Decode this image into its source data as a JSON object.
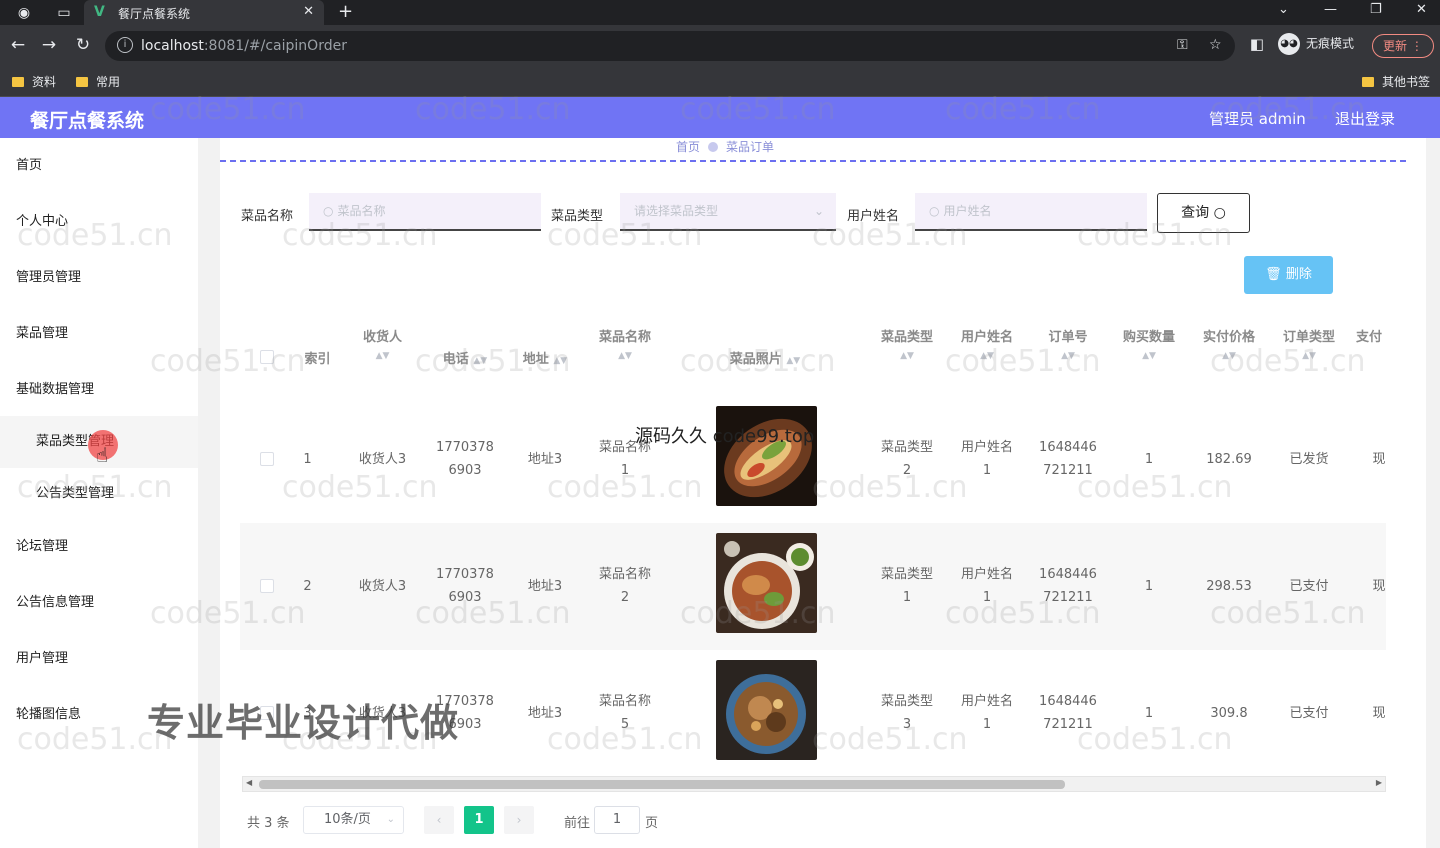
{
  "browser": {
    "tab_title": "餐厅点餐系统",
    "url_host": "localhost",
    "url_rest": ":8081/#/caipinOrder",
    "incognito_label": "无痕模式",
    "update_label": "更新",
    "bookmarks": [
      "资料",
      "常用"
    ],
    "other_bookmarks": "其他书签"
  },
  "header": {
    "title": "餐厅点餐系统",
    "user": "管理员 admin",
    "logout": "退出登录"
  },
  "sidebar": {
    "items": [
      "首页",
      "个人中心",
      "管理员管理",
      "菜品管理",
      "基础数据管理",
      "菜品类型管理",
      "公告类型管理",
      "论坛管理",
      "公告信息管理",
      "用户管理",
      "轮播图信息"
    ]
  },
  "breadcrumb": {
    "home": "首页",
    "current": "菜品订单"
  },
  "filters": {
    "dish_name_label": "菜品名称",
    "dish_name_placeholder": "菜品名称",
    "dish_type_label": "菜品类型",
    "dish_type_placeholder": "请选择菜品类型",
    "user_name_label": "用户姓名",
    "user_name_placeholder": "用户姓名",
    "query_label": "查询",
    "delete_label": "删除"
  },
  "table": {
    "headers": {
      "index": "索引",
      "receiver": "收货人",
      "phone": "电话",
      "address": "地址",
      "dish_name": "菜品名称",
      "dish_photo": "菜品照片",
      "dish_type": "菜品类型",
      "user_name": "用户姓名",
      "order_no": "订单号",
      "qty": "购买数量",
      "price": "实付价格",
      "order_type": "订单类型",
      "pay": "支付"
    },
    "rows": [
      {
        "index": "1",
        "receiver": "收货人3",
        "phone_a": "1770378",
        "phone_b": "6903",
        "address": "地址3",
        "dish_a": "菜品名称",
        "dish_b": "1",
        "type_a": "菜品类型",
        "type_b": "2",
        "user_a": "用户姓名",
        "user_b": "1",
        "order_a": "1648446",
        "order_b": "721211",
        "qty": "1",
        "price": "182.69",
        "order_type": "已发货",
        "pay": "现"
      },
      {
        "index": "2",
        "receiver": "收货人3",
        "phone_a": "1770378",
        "phone_b": "6903",
        "address": "地址3",
        "dish_a": "菜品名称",
        "dish_b": "2",
        "type_a": "菜品类型",
        "type_b": "1",
        "user_a": "用户姓名",
        "user_b": "1",
        "order_a": "1648446",
        "order_b": "721211",
        "qty": "1",
        "price": "298.53",
        "order_type": "已支付",
        "pay": "现"
      },
      {
        "index": "3",
        "receiver": "收货人3",
        "phone_a": "1770378",
        "phone_b": "6903",
        "address": "地址3",
        "dish_a": "菜品名称",
        "dish_b": "5",
        "type_a": "菜品类型",
        "type_b": "3",
        "user_a": "用户姓名",
        "user_b": "1",
        "order_a": "1648446",
        "order_b": "721211",
        "qty": "1",
        "price": "309.8",
        "order_type": "已支付",
        "pay": "现"
      }
    ]
  },
  "pagination": {
    "total": "共 3 条",
    "page_size": "10条/页",
    "current": "1",
    "goto_prefix": "前往",
    "goto_value": "1",
    "goto_suffix": "页"
  },
  "watermarks": {
    "repeat": "code51.cn",
    "overlay_big": "专业毕业设计代做",
    "overlay_mid": "源码久久  code99.top"
  },
  "colors": {
    "header": "#7074f4",
    "accent_green": "#13c48a",
    "delete_blue": "#66c3f5"
  }
}
